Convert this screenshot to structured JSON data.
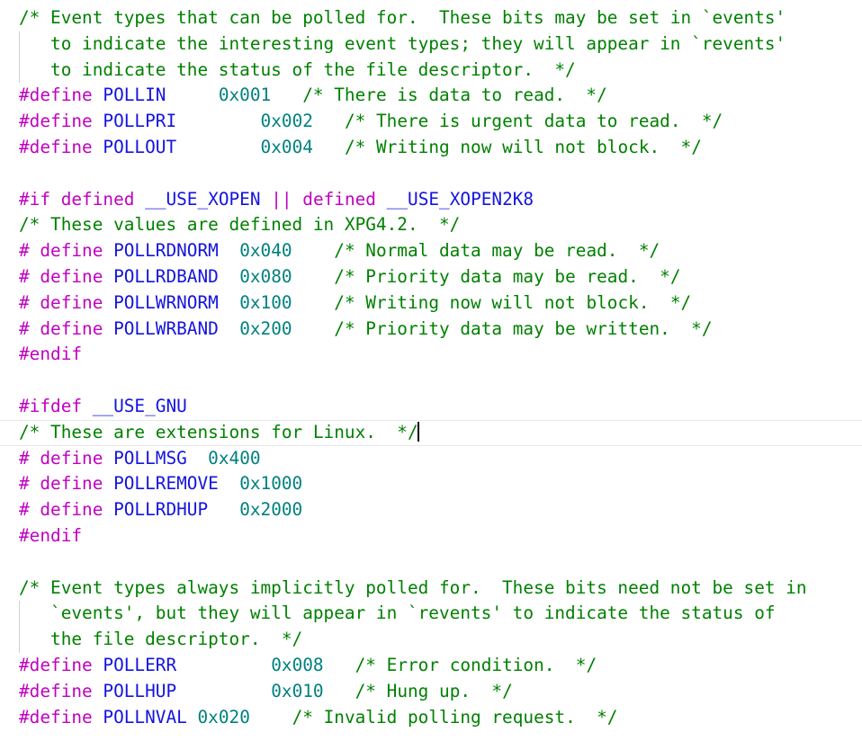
{
  "editor": {
    "kind": "source-code-editor",
    "language": "C",
    "background_color": "#ffffff",
    "caret_line_index": 16,
    "colors": {
      "comment": "#008000",
      "preprocessor": "#C000C0",
      "identifier": "#1414E0",
      "number": "#008080",
      "plain_text": "#000000",
      "indent_guide": "#d0d0d0",
      "current_line_rule": "#e8e8e8",
      "caret": "#000000"
    },
    "lines": [
      {
        "id": "line-1",
        "guide": false,
        "current": false,
        "tokens": [
          {
            "c": "cmt",
            "t": "/* Event types that can be polled for.  These bits may be set in `events'"
          }
        ]
      },
      {
        "id": "line-2",
        "guide": true,
        "current": false,
        "tokens": [
          {
            "c": "cmt",
            "t": "   to indicate the interesting event types; they will appear in `revents'"
          }
        ]
      },
      {
        "id": "line-3",
        "guide": true,
        "current": false,
        "tokens": [
          {
            "c": "cmt",
            "t": "   to indicate the status of the file descriptor.  */"
          }
        ]
      },
      {
        "id": "line-4",
        "guide": false,
        "current": false,
        "tokens": [
          {
            "c": "pre",
            "t": "#define "
          },
          {
            "c": "id",
            "t": "POLLIN"
          },
          {
            "c": "plain",
            "t": "     "
          },
          {
            "c": "num",
            "t": "0x001"
          },
          {
            "c": "plain",
            "t": "   "
          },
          {
            "c": "cmt",
            "t": "/* There is data to read.  */"
          }
        ]
      },
      {
        "id": "line-5",
        "guide": false,
        "current": false,
        "tokens": [
          {
            "c": "pre",
            "t": "#define "
          },
          {
            "c": "id",
            "t": "POLLPRI"
          },
          {
            "c": "plain",
            "t": "        "
          },
          {
            "c": "num",
            "t": "0x002"
          },
          {
            "c": "plain",
            "t": "   "
          },
          {
            "c": "cmt",
            "t": "/* There is urgent data to read.  */"
          }
        ]
      },
      {
        "id": "line-6",
        "guide": false,
        "current": false,
        "tokens": [
          {
            "c": "pre",
            "t": "#define "
          },
          {
            "c": "id",
            "t": "POLLOUT"
          },
          {
            "c": "plain",
            "t": "        "
          },
          {
            "c": "num",
            "t": "0x004"
          },
          {
            "c": "plain",
            "t": "   "
          },
          {
            "c": "cmt",
            "t": "/* Writing now will not block.  */"
          }
        ]
      },
      {
        "id": "line-7",
        "guide": false,
        "current": false,
        "tokens": []
      },
      {
        "id": "line-8",
        "guide": false,
        "current": false,
        "tokens": [
          {
            "c": "pre",
            "t": "#if "
          },
          {
            "c": "pre",
            "t": "defined "
          },
          {
            "c": "id",
            "t": "__USE_XOPEN"
          },
          {
            "c": "plain",
            "t": " "
          },
          {
            "c": "op",
            "t": "||"
          },
          {
            "c": "plain",
            "t": " "
          },
          {
            "c": "pre",
            "t": "defined "
          },
          {
            "c": "id",
            "t": "__USE_XOPEN2K8"
          }
        ]
      },
      {
        "id": "line-9",
        "guide": false,
        "current": false,
        "tokens": [
          {
            "c": "cmt",
            "t": "/* These values are defined in XPG4.2.  */"
          }
        ]
      },
      {
        "id": "line-10",
        "guide": false,
        "current": false,
        "tokens": [
          {
            "c": "pre",
            "t": "# define "
          },
          {
            "c": "id",
            "t": "POLLRDNORM"
          },
          {
            "c": "plain",
            "t": "  "
          },
          {
            "c": "num",
            "t": "0x040"
          },
          {
            "c": "plain",
            "t": "    "
          },
          {
            "c": "cmt",
            "t": "/* Normal data may be read.  */"
          }
        ]
      },
      {
        "id": "line-11",
        "guide": false,
        "current": false,
        "tokens": [
          {
            "c": "pre",
            "t": "# define "
          },
          {
            "c": "id",
            "t": "POLLRDBAND"
          },
          {
            "c": "plain",
            "t": "  "
          },
          {
            "c": "num",
            "t": "0x080"
          },
          {
            "c": "plain",
            "t": "    "
          },
          {
            "c": "cmt",
            "t": "/* Priority data may be read.  */"
          }
        ]
      },
      {
        "id": "line-12",
        "guide": false,
        "current": false,
        "tokens": [
          {
            "c": "pre",
            "t": "# define "
          },
          {
            "c": "id",
            "t": "POLLWRNORM"
          },
          {
            "c": "plain",
            "t": "  "
          },
          {
            "c": "num",
            "t": "0x100"
          },
          {
            "c": "plain",
            "t": "    "
          },
          {
            "c": "cmt",
            "t": "/* Writing now will not block.  */"
          }
        ]
      },
      {
        "id": "line-13",
        "guide": false,
        "current": false,
        "tokens": [
          {
            "c": "pre",
            "t": "# define "
          },
          {
            "c": "id",
            "t": "POLLWRBAND"
          },
          {
            "c": "plain",
            "t": "  "
          },
          {
            "c": "num",
            "t": "0x200"
          },
          {
            "c": "plain",
            "t": "    "
          },
          {
            "c": "cmt",
            "t": "/* Priority data may be written.  */"
          }
        ]
      },
      {
        "id": "line-14",
        "guide": false,
        "current": false,
        "tokens": [
          {
            "c": "pre",
            "t": "#endif"
          }
        ]
      },
      {
        "id": "line-15",
        "guide": false,
        "current": false,
        "tokens": []
      },
      {
        "id": "line-16",
        "guide": false,
        "current": false,
        "tokens": [
          {
            "c": "pre",
            "t": "#ifdef "
          },
          {
            "c": "id",
            "t": "__USE_GNU"
          }
        ]
      },
      {
        "id": "line-17",
        "guide": false,
        "current": true,
        "tokens": [
          {
            "c": "cmt",
            "t": "/* These are extensions for Linux.  */"
          }
        ]
      },
      {
        "id": "line-18",
        "guide": false,
        "current": false,
        "tokens": [
          {
            "c": "pre",
            "t": "# define "
          },
          {
            "c": "id",
            "t": "POLLMSG"
          },
          {
            "c": "plain",
            "t": "  "
          },
          {
            "c": "num",
            "t": "0x400"
          }
        ]
      },
      {
        "id": "line-19",
        "guide": false,
        "current": false,
        "tokens": [
          {
            "c": "pre",
            "t": "# define "
          },
          {
            "c": "id",
            "t": "POLLREMOVE"
          },
          {
            "c": "plain",
            "t": "  "
          },
          {
            "c": "num",
            "t": "0x1000"
          }
        ]
      },
      {
        "id": "line-20",
        "guide": false,
        "current": false,
        "tokens": [
          {
            "c": "pre",
            "t": "# define "
          },
          {
            "c": "id",
            "t": "POLLRDHUP"
          },
          {
            "c": "plain",
            "t": "   "
          },
          {
            "c": "num",
            "t": "0x2000"
          }
        ]
      },
      {
        "id": "line-21",
        "guide": false,
        "current": false,
        "tokens": [
          {
            "c": "pre",
            "t": "#endif"
          }
        ]
      },
      {
        "id": "line-22",
        "guide": false,
        "current": false,
        "tokens": []
      },
      {
        "id": "line-23",
        "guide": false,
        "current": false,
        "tokens": [
          {
            "c": "cmt",
            "t": "/* Event types always implicitly polled for.  These bits need not be set in"
          }
        ]
      },
      {
        "id": "line-24",
        "guide": true,
        "current": false,
        "tokens": [
          {
            "c": "cmt",
            "t": "   `events', but they will appear in `revents' to indicate the status of"
          }
        ]
      },
      {
        "id": "line-25",
        "guide": true,
        "current": false,
        "tokens": [
          {
            "c": "cmt",
            "t": "   the file descriptor.  */"
          }
        ]
      },
      {
        "id": "line-26",
        "guide": false,
        "current": false,
        "tokens": [
          {
            "c": "pre",
            "t": "#define "
          },
          {
            "c": "id",
            "t": "POLLERR"
          },
          {
            "c": "plain",
            "t": "         "
          },
          {
            "c": "num",
            "t": "0x008"
          },
          {
            "c": "plain",
            "t": "   "
          },
          {
            "c": "cmt",
            "t": "/* Error condition.  */"
          }
        ]
      },
      {
        "id": "line-27",
        "guide": false,
        "current": false,
        "tokens": [
          {
            "c": "pre",
            "t": "#define "
          },
          {
            "c": "id",
            "t": "POLLHUP"
          },
          {
            "c": "plain",
            "t": "         "
          },
          {
            "c": "num",
            "t": "0x010"
          },
          {
            "c": "plain",
            "t": "   "
          },
          {
            "c": "cmt",
            "t": "/* Hung up.  */"
          }
        ]
      },
      {
        "id": "line-28",
        "guide": false,
        "current": false,
        "tokens": [
          {
            "c": "pre",
            "t": "#define "
          },
          {
            "c": "id",
            "t": "POLLNVAL"
          },
          {
            "c": "plain",
            "t": " "
          },
          {
            "c": "num",
            "t": "0x020"
          },
          {
            "c": "plain",
            "t": "    "
          },
          {
            "c": "cmt",
            "t": "/* Invalid polling request.  */"
          }
        ]
      }
    ]
  }
}
